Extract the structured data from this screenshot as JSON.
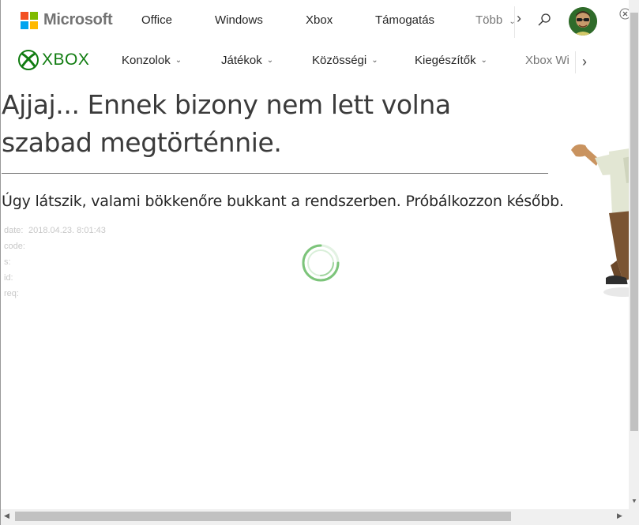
{
  "ms_header": {
    "brand": "Microsoft",
    "logo_colors": [
      "#f25022",
      "#7fba00",
      "#00a4ef",
      "#ffb900"
    ],
    "nav": [
      "Office",
      "Windows",
      "Xbox",
      "Támogatás"
    ],
    "more_label": "Több",
    "more_icon": "chevron-down-icon",
    "scroll_icon": "chevron-right-icon",
    "search_icon": "search-icon",
    "close_icon": "close-circle-icon"
  },
  "xbox_header": {
    "brand": "XBOX",
    "brand_color": "#107c10",
    "nav": [
      {
        "label": "Konzolok",
        "caret": "⌄"
      },
      {
        "label": "Játékok",
        "caret": "⌄"
      },
      {
        "label": "Közösségi",
        "caret": "⌄"
      },
      {
        "label": "Kiegészítők",
        "caret": "⌄"
      }
    ],
    "more_label": "Xbox Wi",
    "next_icon": "chevron-right-icon"
  },
  "error": {
    "title": "Ajjaj... Ennek bizony nem lett volna szabad megtörténnie.",
    "description": "Úgy látszik, valami bökkenőre bukkant a rendszerben. Próbálkozzon később.",
    "diagnostics": [
      {
        "key": "date:",
        "value": "2018.04.23. 8:01:43"
      },
      {
        "key": "code:",
        "value": ""
      },
      {
        "key": "s:",
        "value": ""
      },
      {
        "key": "id:",
        "value": ""
      },
      {
        "key": "req:",
        "value": ""
      }
    ]
  },
  "spinner": {
    "icon": "loading-spinner-icon",
    "color": "#7cc47a"
  },
  "scrollbars": {
    "up": "▲",
    "down": "▼",
    "left": "◀",
    "right": "▶"
  }
}
